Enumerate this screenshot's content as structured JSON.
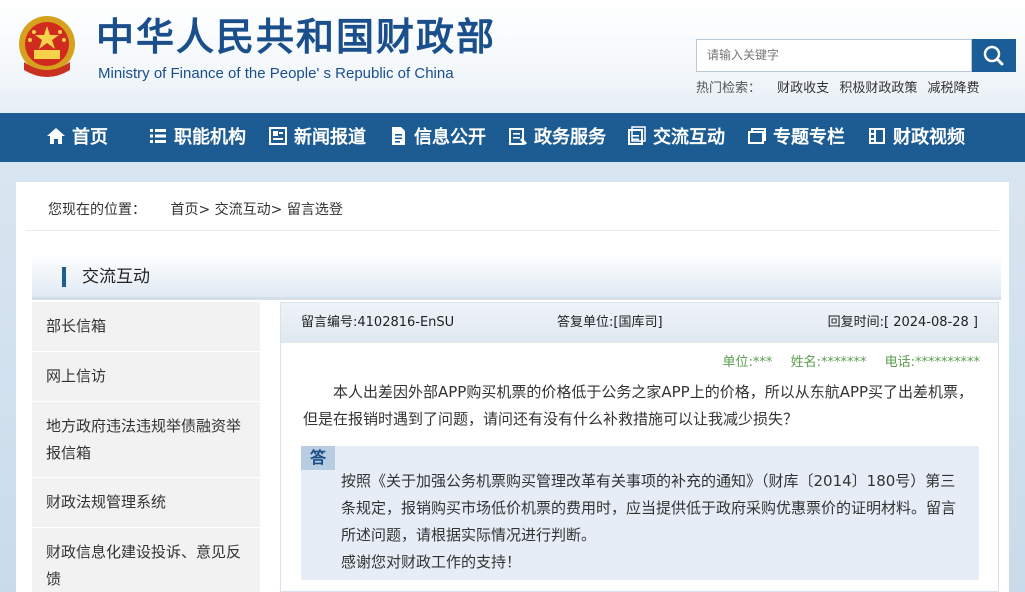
{
  "header": {
    "title_cn": "中华人民共和国财政部",
    "title_en": "Ministry of Finance of the People' s Republic of China",
    "search": {
      "placeholder": "请输入关键字"
    },
    "hot_label": "热门检索：",
    "hot_items": [
      "财政收支",
      "积极财政政策",
      "减税降费"
    ]
  },
  "nav": [
    {
      "label": "首页",
      "icon": "home-icon"
    },
    {
      "label": "职能机构",
      "icon": "list-icon"
    },
    {
      "label": "新闻报道",
      "icon": "news-icon"
    },
    {
      "label": "信息公开",
      "icon": "document-icon"
    },
    {
      "label": "政务服务",
      "icon": "service-icon"
    },
    {
      "label": "交流互动",
      "icon": "chat-icon"
    },
    {
      "label": "专题专栏",
      "icon": "folder-icon"
    },
    {
      "label": "财政视频",
      "icon": "video-icon"
    }
  ],
  "breadcrumb": {
    "label": "您现在的位置：",
    "items": [
      "首页>",
      "交流互动>",
      "留言选登"
    ]
  },
  "section": {
    "title": "交流互动"
  },
  "sidebar": {
    "items": [
      "部长信箱",
      "网上信访",
      "地方政府违法违规举债融资举报信箱",
      "财政法规管理系统",
      "财政信息化建设投诉、意见反馈"
    ]
  },
  "message": {
    "id": "留言编号:4102816-EnSU",
    "dept": "答复单位:[国库司]",
    "reply_time": "回复时间:[ 2024-08-28 ]",
    "meta": {
      "unit": "单位:***",
      "name": "姓名:*******",
      "phone": "电话:**********"
    },
    "body": "本人出差因外部APP购买机票的价格低于公务之家APP上的价格，所以从东航APP买了出差机票，但是在报销时遇到了问题，请问还有没有什么补救措施可以让我减少损失？",
    "answer_tag": "答",
    "answer": "按照《关于加强公务机票购买管理改革有关事项的补充的通知》（财库〔2014〕180号）第三条规定，报销购买市场低价机票的费用时，应当提供低于政府采购优惠票价的证明材料。留言所述问题，请根据实际情况进行判断。",
    "thanks": "感谢您对财政工作的支持！"
  },
  "colors": {
    "brand": "#1d5c93",
    "title": "#1a4f8c",
    "meta_green": "#5a9e4d"
  }
}
